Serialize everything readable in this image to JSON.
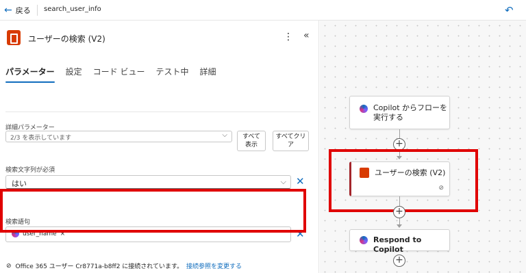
{
  "topbar": {
    "back_label": "戻る",
    "flow_name": "search_user_info"
  },
  "panel": {
    "title": "ユーザーの検索 (V2)",
    "tabs": [
      {
        "label": "パラメーター",
        "active": true
      },
      {
        "label": "設定"
      },
      {
        "label": "コード ビュー"
      },
      {
        "label": "テスト中"
      },
      {
        "label": "詳細"
      }
    ],
    "advanced": {
      "label": "詳細パラメーター",
      "select_value": "2/3 を表示しています",
      "show_all_line1": "すべて",
      "show_all_line2": "表示",
      "clear_all_line1": "すべてクリ",
      "clear_all_line2": "ア"
    },
    "search_required": {
      "label": "検索文字列が必須",
      "value": "はい"
    },
    "search_term": {
      "label": "検索語句",
      "token": "user_name",
      "token_remove": "×"
    },
    "connection": {
      "text": "Office 365 ユーザー Cr8771a-b8ff2 に接続されています。",
      "change_link": "接続参照を変更する"
    }
  },
  "canvas": {
    "trigger_line1": "Copilot からフローを",
    "trigger_line2": "実行する",
    "action_title": "ユーザーの検索 (V2)",
    "respond_title": "Respond to Copilot"
  },
  "colors": {
    "accent": "#0f6cbd",
    "highlight": "#e00000",
    "office": "#d83b01"
  }
}
